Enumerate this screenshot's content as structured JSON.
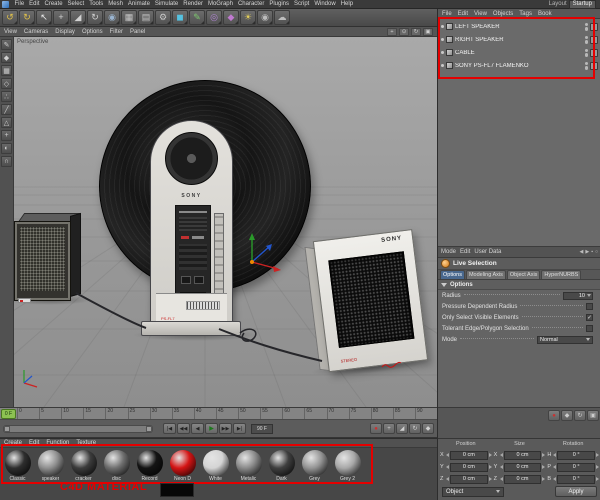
{
  "menubar": {
    "items": [
      {
        "label": "File"
      },
      {
        "label": "Edit"
      },
      {
        "label": "Create"
      },
      {
        "label": "Select"
      },
      {
        "label": "Tools"
      },
      {
        "label": "Mesh"
      },
      {
        "label": "Animate"
      },
      {
        "label": "Simulate"
      },
      {
        "label": "Render"
      },
      {
        "label": "MoGraph"
      },
      {
        "label": "Character"
      },
      {
        "label": "Plugins"
      },
      {
        "label": "Script"
      },
      {
        "label": "Window"
      },
      {
        "label": "Help"
      }
    ]
  },
  "layout_switcher": {
    "label": "Layout",
    "value": "Startup"
  },
  "toolbar": {
    "icons": [
      {
        "name": "undo-icon",
        "glyph": "↺",
        "color": "#e2c24a"
      },
      {
        "name": "redo-icon",
        "glyph": "↻",
        "color": "#e2c24a"
      },
      {
        "name": "live-selection-icon",
        "glyph": "↖",
        "color": "#ececec"
      },
      {
        "name": "move-tool-icon",
        "glyph": "+",
        "color": "#d2d2d2"
      },
      {
        "name": "scale-tool-icon",
        "glyph": "◢",
        "color": "#d2d2d2"
      },
      {
        "name": "rotate-tool-icon",
        "glyph": "↻",
        "color": "#d2d2d2"
      },
      {
        "name": "coordinate-system-icon",
        "glyph": "◉",
        "color": "#9ab4d0"
      },
      {
        "name": "render-view-icon",
        "glyph": "▦",
        "color": "#c8c8c8"
      },
      {
        "name": "render-picture-viewer-icon",
        "glyph": "▤",
        "color": "#c8c8c8"
      },
      {
        "name": "render-settings-icon",
        "glyph": "⚙",
        "color": "#c8c8c8"
      },
      {
        "name": "add-cube-icon",
        "glyph": "◼",
        "color": "#55c2e0"
      },
      {
        "name": "add-spline-icon",
        "glyph": "✎",
        "color": "#7ec96f"
      },
      {
        "name": "add-generator-icon",
        "glyph": "◎",
        "color": "#b386d8"
      },
      {
        "name": "add-deformer-icon",
        "glyph": "◆",
        "color": "#c07ad0"
      },
      {
        "name": "add-light-icon",
        "glyph": "☀",
        "color": "#e2cd58"
      },
      {
        "name": "add-camera-icon",
        "glyph": "◉",
        "color": "#bcbcbc"
      },
      {
        "name": "add-environment-icon",
        "glyph": "☁",
        "color": "#bcbcbc"
      }
    ]
  },
  "viewport": {
    "label": "Perspective",
    "menus": [
      {
        "label": "View"
      },
      {
        "label": "Cameras"
      },
      {
        "label": "Display"
      },
      {
        "label": "Options"
      },
      {
        "label": "Filter"
      },
      {
        "label": "Panel"
      }
    ],
    "corner_icons": [
      {
        "name": "pan-view-icon",
        "glyph": "+"
      },
      {
        "name": "zoom-view-icon",
        "glyph": "⊙"
      },
      {
        "name": "rotate-view-icon",
        "glyph": "↻"
      },
      {
        "name": "toggle-view-icon",
        "glyph": "▣"
      }
    ],
    "scene": {
      "player_brand": "SONY",
      "player_caption": "PS-FL7",
      "speaker_brand": "SONY",
      "speaker_caption": "STEREO"
    }
  },
  "sidebar": {
    "icons": [
      {
        "name": "make-editable-icon",
        "glyph": "✎"
      },
      {
        "name": "model-mode-icon",
        "glyph": "◆"
      },
      {
        "name": "texture-mode-icon",
        "glyph": "▦"
      },
      {
        "name": "workplane-mode-icon",
        "glyph": "◇"
      },
      {
        "name": "points-mode-icon",
        "glyph": "∴"
      },
      {
        "name": "edges-mode-icon",
        "glyph": "╱"
      },
      {
        "name": "polygons-mode-icon",
        "glyph": "△"
      },
      {
        "name": "enable-axis-icon",
        "glyph": "+"
      },
      {
        "name": "viewport-solo-icon",
        "glyph": "◐"
      },
      {
        "name": "snap-icon",
        "glyph": "∩"
      }
    ]
  },
  "object_manager": {
    "menus": [
      {
        "label": "File"
      },
      {
        "label": "Edit"
      },
      {
        "label": "View"
      },
      {
        "label": "Objects"
      },
      {
        "label": "Tags"
      },
      {
        "label": "Book"
      }
    ],
    "objects": [
      {
        "name": "LEFT SPEAKER"
      },
      {
        "name": "RIGHT SPEAKER"
      },
      {
        "name": "CABLE"
      },
      {
        "name": "SONY PS-FL7 FLAMENKO"
      }
    ]
  },
  "attributes": {
    "menu": [
      "Mode",
      "Edit",
      "User Data"
    ],
    "header_icons": [
      {
        "name": "nav-back-icon",
        "glyph": "◀"
      },
      {
        "name": "nav-forward-icon",
        "glyph": "▶"
      },
      {
        "name": "lock-icon",
        "glyph": "▪"
      },
      {
        "name": "search-icon",
        "glyph": "○"
      }
    ],
    "tool": "Live Selection",
    "tabs": [
      {
        "label": "Options",
        "active": true
      },
      {
        "label": "Modeling Axis",
        "active": false
      },
      {
        "label": "Object Axis",
        "active": false
      },
      {
        "label": "HyperNURBS",
        "active": false
      }
    ],
    "section": "Options",
    "radius_label": "Radius",
    "radius_value": "10",
    "checkboxes": [
      {
        "label": "Pressure Dependent Radius",
        "checked": false
      },
      {
        "label": "Only Select Visible Elements",
        "checked": true
      },
      {
        "label": "Tolerant Edge/Polygon Selection",
        "checked": false
      }
    ],
    "mode_label": "Mode",
    "mode_value": "Normal"
  },
  "timeline": {
    "ticks": [
      "0",
      "5",
      "10",
      "15",
      "20",
      "25",
      "30",
      "35",
      "40",
      "45",
      "50",
      "55",
      "60",
      "65",
      "70",
      "75",
      "80",
      "85",
      "90"
    ],
    "playhead_label": "0 F"
  },
  "transport": {
    "buttons": [
      {
        "name": "goto-start-button",
        "glyph": "|◀"
      },
      {
        "name": "prev-key-button",
        "glyph": "◀◀"
      },
      {
        "name": "prev-frame-button",
        "glyph": "◀"
      },
      {
        "name": "play-button",
        "glyph": "▶"
      },
      {
        "name": "next-frame-button",
        "glyph": "▶▶"
      },
      {
        "name": "goto-end-button",
        "glyph": "▶|"
      }
    ],
    "end_frame": "90 F",
    "record_icons": [
      {
        "name": "record-keyframe-icon",
        "glyph": "●",
        "color": "#cc3030"
      },
      {
        "name": "record-position-icon",
        "glyph": "+",
        "color": "#d0d0d0"
      },
      {
        "name": "record-scale-icon",
        "glyph": "◢",
        "color": "#d0d0d0"
      },
      {
        "name": "record-rotation-icon",
        "glyph": "↻",
        "color": "#d0d0d0"
      },
      {
        "name": "record-parameter-icon",
        "glyph": "◆",
        "color": "#d0d0d0"
      }
    ]
  },
  "panel_strip": {
    "icons": [
      {
        "name": "autokey-icon",
        "glyph": "●",
        "color": "#cc3030"
      },
      {
        "name": "keyframe-icon",
        "glyph": "◆",
        "color": "#cccccc"
      },
      {
        "name": "refresh-icon",
        "glyph": "↻",
        "color": "#cccccc"
      },
      {
        "name": "snapshot-icon",
        "glyph": "▣",
        "color": "#cccccc"
      }
    ]
  },
  "materials": {
    "menus": [
      {
        "label": "Create"
      },
      {
        "label": "Edit"
      },
      {
        "label": "Function"
      },
      {
        "label": "Texture"
      }
    ],
    "items": [
      {
        "name": "Classic",
        "color": "#2e2e2e"
      },
      {
        "name": "speaker",
        "color": "#8f8f8f"
      },
      {
        "name": "cracker",
        "color": "#3c3c3c"
      },
      {
        "name": "disc",
        "color": "#6f6f6f"
      },
      {
        "name": "Record",
        "color": "#141414"
      },
      {
        "name": "Neon D",
        "color": "#d41414"
      },
      {
        "name": "White",
        "color": "#d4d4d4"
      },
      {
        "name": "Metalic",
        "color": "#8a8a8a"
      },
      {
        "name": "Dark",
        "color": "#3f3f3f"
      },
      {
        "name": "Grey",
        "color": "#949494"
      },
      {
        "name": "Grey 2",
        "color": "#a8a8a8"
      }
    ]
  },
  "coordinates": {
    "titles": [
      "Position",
      "Size",
      "Rotation"
    ],
    "position": [
      {
        "axis": "X",
        "value": "0 cm"
      },
      {
        "axis": "Y",
        "value": "0 cm"
      },
      {
        "axis": "Z",
        "value": "0 cm"
      }
    ],
    "size": [
      {
        "axis": "X",
        "value": "0 cm"
      },
      {
        "axis": "Y",
        "value": "0 cm"
      },
      {
        "axis": "Z",
        "value": "0 cm"
      }
    ],
    "rotation": [
      {
        "axis": "H",
        "value": "0 °"
      },
      {
        "axis": "P",
        "value": "0 °"
      },
      {
        "axis": "B",
        "value": "0 °"
      }
    ],
    "space": "Object",
    "apply_label": "Apply"
  },
  "annotations": {
    "material_label": "C4D MATERIAL",
    "box_color": "#e40000"
  }
}
